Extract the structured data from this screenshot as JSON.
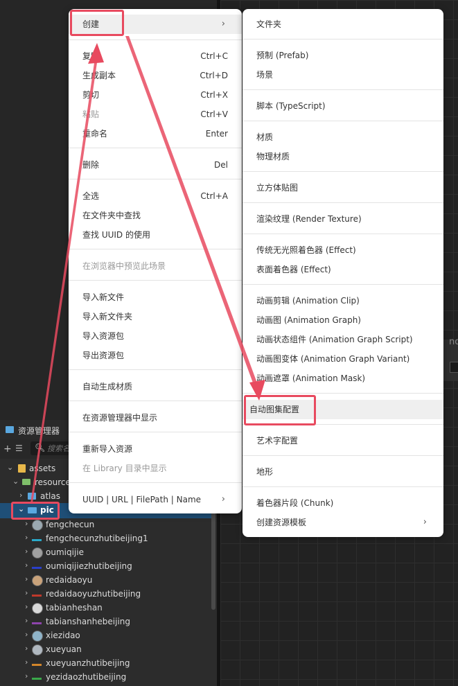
{
  "background": {
    "partial_text": "no"
  },
  "assets_panel": {
    "title": "资源管理器",
    "search_placeholder": "搜索名",
    "tree": [
      {
        "label": "assets"
      },
      {
        "label": "resources"
      },
      {
        "label": "atlas"
      },
      {
        "label": "pic"
      },
      {
        "label": "fengchecun"
      },
      {
        "label": "fengchecunzhutibeijing1"
      },
      {
        "label": "oumiqijie"
      },
      {
        "label": "oumiqijiezhutibeijing"
      },
      {
        "label": "redaidaoyu"
      },
      {
        "label": "redaidaoyuzhutibeijing"
      },
      {
        "label": "tabianheshan"
      },
      {
        "label": "tabianshanhebeijing"
      },
      {
        "label": "xiezidao"
      },
      {
        "label": "xueyuan"
      },
      {
        "label": "xueyuanzhutibeijing"
      },
      {
        "label": "yezidaozhutibeijing"
      }
    ]
  },
  "context_menu": {
    "items": [
      {
        "label": "创建"
      },
      {
        "label": "复制",
        "shortcut": "Ctrl+C"
      },
      {
        "label": "生成副本",
        "shortcut": "Ctrl+D"
      },
      {
        "label": "剪切",
        "shortcut": "Ctrl+X"
      },
      {
        "label": "粘贴",
        "shortcut": "Ctrl+V"
      },
      {
        "label": "重命名",
        "shortcut": "Enter"
      },
      {
        "label": "删除",
        "shortcut": "Del"
      },
      {
        "label": "全选",
        "shortcut": "Ctrl+A"
      },
      {
        "label": "在文件夹中查找"
      },
      {
        "label": "查找 UUID 的使用"
      },
      {
        "label": "在浏览器中预览此场景"
      },
      {
        "label": "导入新文件"
      },
      {
        "label": "导入新文件夹"
      },
      {
        "label": "导入资源包"
      },
      {
        "label": "导出资源包"
      },
      {
        "label": "自动生成材质"
      },
      {
        "label": "在资源管理器中显示"
      },
      {
        "label": "重新导入资源"
      },
      {
        "label": "在 Library 目录中显示"
      },
      {
        "label": "UUID | URL | FilePath | Name"
      }
    ]
  },
  "submenu": {
    "items": [
      {
        "label": "文件夹"
      },
      {
        "label": "预制 (Prefab)"
      },
      {
        "label": "场景"
      },
      {
        "label": "脚本 (TypeScript)"
      },
      {
        "label": "材质"
      },
      {
        "label": "物理材质"
      },
      {
        "label": "立方体贴图"
      },
      {
        "label": "渲染纹理 (Render Texture)"
      },
      {
        "label": "传统无光照着色器 (Effect)"
      },
      {
        "label": "表面着色器 (Effect)"
      },
      {
        "label": "动画剪辑 (Animation Clip)"
      },
      {
        "label": "动画图 (Animation Graph)"
      },
      {
        "label": "动画状态组件 (Animation Graph Script)"
      },
      {
        "label": "动画图变体 (Animation Graph Variant)"
      },
      {
        "label": "动画遮罩 (Animation Mask)"
      },
      {
        "label": "自动图集配置"
      },
      {
        "label": "艺术字配置"
      },
      {
        "label": "地形"
      },
      {
        "label": "着色器片段 (Chunk)"
      },
      {
        "label": "创建资源模板"
      }
    ]
  },
  "icons": {
    "chevron": "chevron-right-icon",
    "folder": "folder-icon",
    "image": "image-thumbnail-icon"
  },
  "colors": {
    "annotation": "#e84a5f",
    "selection": "#1f4f77",
    "folder": "#5aa8e0"
  }
}
